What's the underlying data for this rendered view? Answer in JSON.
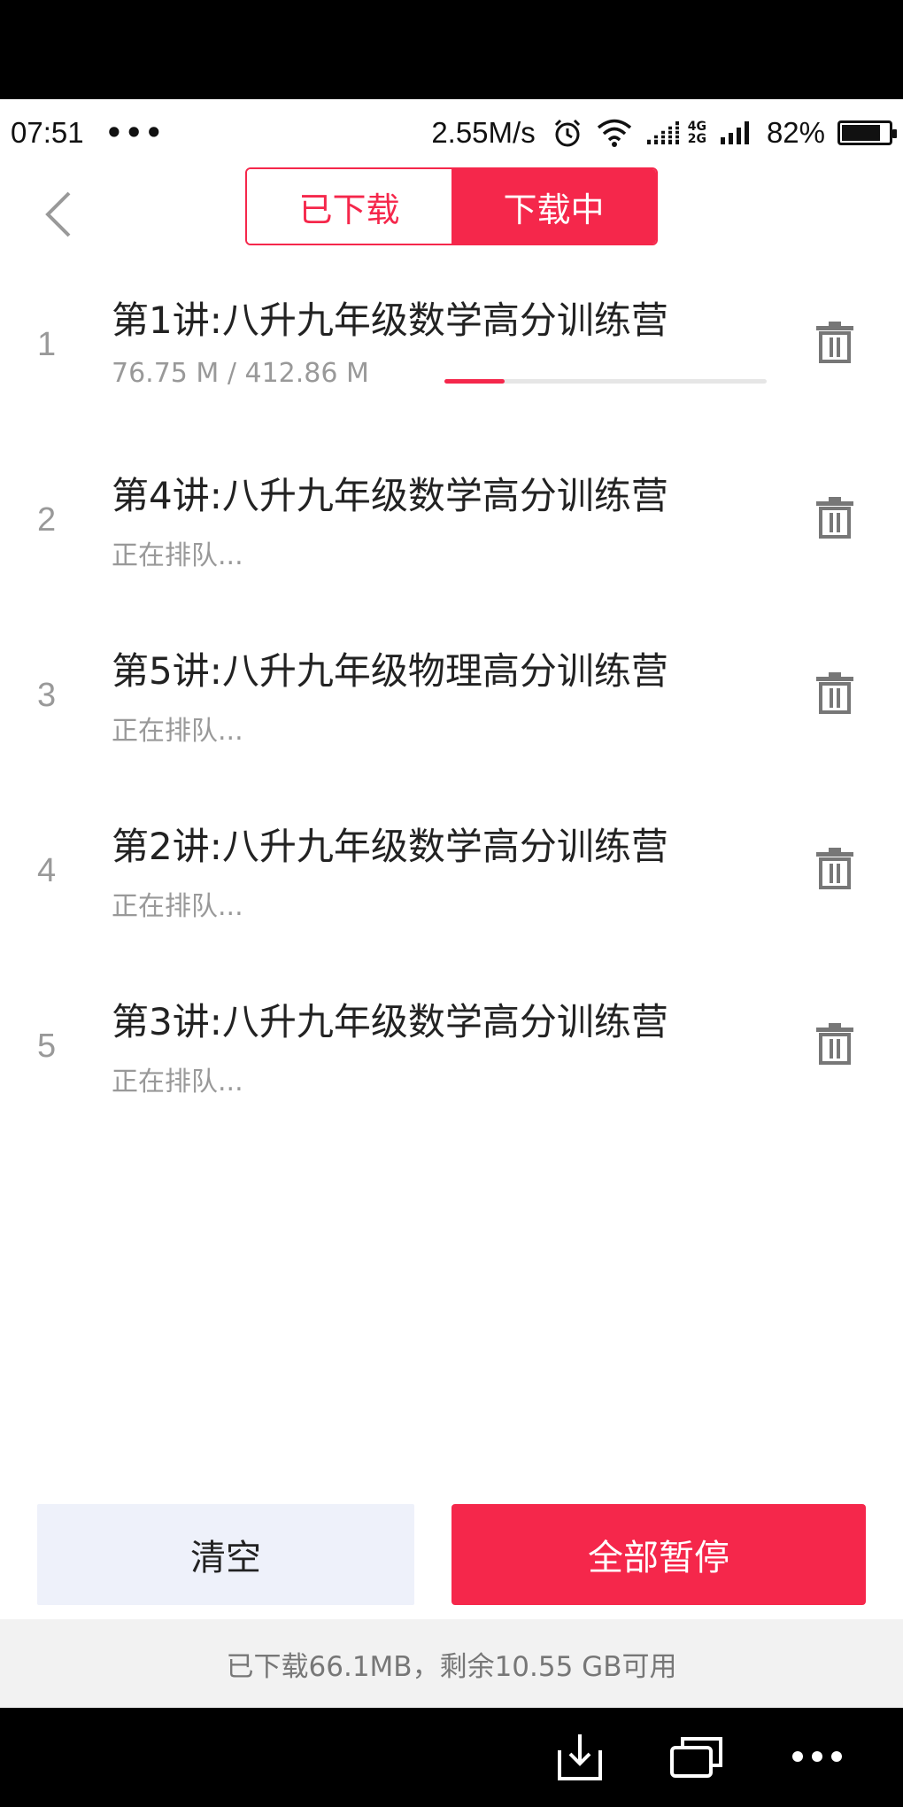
{
  "status_bar": {
    "time": "07:51",
    "dots": "•••",
    "speed": "2.55M/s",
    "net_top": "4G",
    "net_bottom": "2G",
    "battery_pct": "82%",
    "battery_level": 0.82
  },
  "header": {
    "tabs": [
      {
        "label": "已下载",
        "active": false
      },
      {
        "label": "下载中",
        "active": true
      }
    ]
  },
  "downloads": [
    {
      "index": "1",
      "title": "第1讲:八升九年级数学高分训练营",
      "subtitle": "76.75 M / 412.86 M",
      "progress": 0.186
    },
    {
      "index": "2",
      "title": "第4讲:八升九年级数学高分训练营",
      "subtitle": "正在排队..."
    },
    {
      "index": "3",
      "title": "第5讲:八升九年级物理高分训练营",
      "subtitle": "正在排队..."
    },
    {
      "index": "4",
      "title": "第2讲:八升九年级数学高分训练营",
      "subtitle": "正在排队..."
    },
    {
      "index": "5",
      "title": "第3讲:八升九年级数学高分训练营",
      "subtitle": "正在排队..."
    }
  ],
  "actions": {
    "clear_label": "清空",
    "pause_all_label": "全部暂停"
  },
  "storage_text": "已下载66.1MB，剩余10.55 GB可用",
  "colors": {
    "accent": "#f5274b",
    "clear_bg": "#eef1fa",
    "muted_text": "#999999"
  }
}
